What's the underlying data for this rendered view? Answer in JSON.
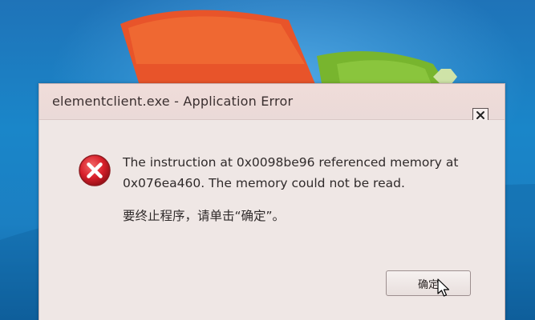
{
  "window": {
    "title": "elementclient.exe - Application Error"
  },
  "message": {
    "line1": "The instruction at 0x0098be96 referenced memory at",
    "line2": "0x076ea460. The memory could not be read.",
    "line3": "要终止程序，请单击“确定”。"
  },
  "buttons": {
    "ok_label": "确定"
  },
  "icons": {
    "close": "close-icon",
    "error": "error-icon",
    "cursor": "mouse-cursor-icon"
  },
  "colors": {
    "error_red": "#d8202b",
    "desktop_blue": "#1a86c9",
    "dialog_bg": "#efe7e5"
  }
}
